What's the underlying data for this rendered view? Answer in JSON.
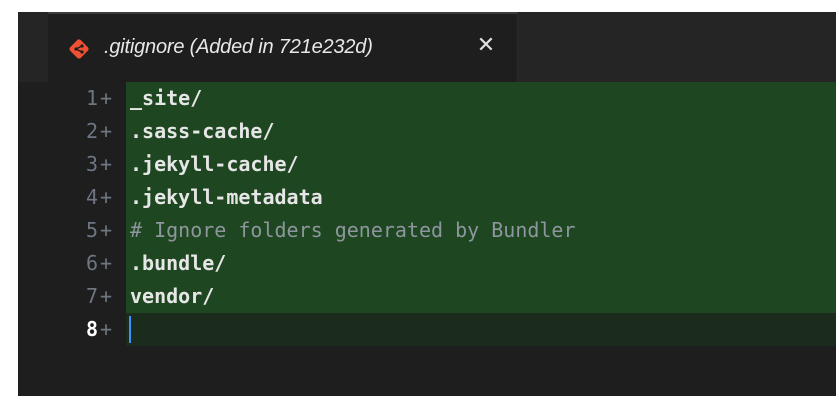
{
  "tab": {
    "title": ".gitignore (Added in 721e232d)",
    "icon": "git-icon",
    "close_glyph": "✕"
  },
  "colors": {
    "editor_bg": "#1e1e1e",
    "added_line_bg": "#1e4620",
    "git_icon": "#f05033",
    "cursor": "#3794ff"
  },
  "lines": [
    {
      "number": "1",
      "sign": "+",
      "text": "_site/"
    },
    {
      "number": "2",
      "sign": "+",
      "text": ".sass-cache/"
    },
    {
      "number": "3",
      "sign": "+",
      "text": ".jekyll-cache/"
    },
    {
      "number": "4",
      "sign": "+",
      "text": ".jekyll-metadata"
    },
    {
      "number": "5",
      "sign": "+",
      "text": "# Ignore folders generated by Bundler"
    },
    {
      "number": "6",
      "sign": "+",
      "text": ".bundle/"
    },
    {
      "number": "7",
      "sign": "+",
      "text": "vendor/"
    },
    {
      "number": "8",
      "sign": "+",
      "text": ""
    }
  ]
}
